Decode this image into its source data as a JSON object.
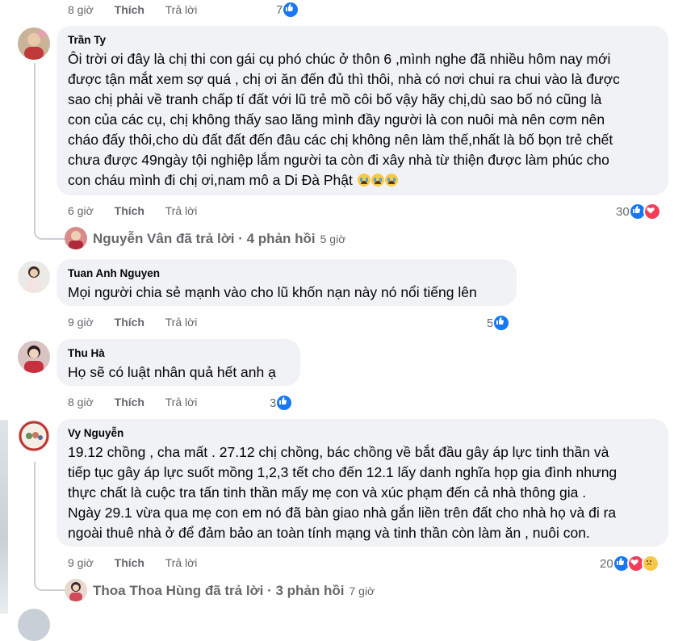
{
  "colors": {
    "like_blue": "#1877f2",
    "love_red": "#f33e58",
    "haha_yellow": "#f7c948",
    "bubble_bg": "#f0f2f5",
    "meta_gray": "#65676b"
  },
  "top_row": {
    "time": "8 giờ",
    "like": "Thích",
    "reply": "Trả lời",
    "reactions": "7"
  },
  "comments": [
    {
      "author": "Trần Ty",
      "text": "Ôi trời ơi đây là chị thi con gái cụ phó chúc ở thôn 6 ,mình nghe đã nhiều hôm nay mới\nđược tận mắt xem sợ quá , chị ơi ăn đến đủ thì thôi, nhà có nơi chui ra chui vào là được\nsao chị phải về tranh chấp tí đất với lũ trẻ mồ côi bố vậy hãy chị,dù sao bố nó cũng là\ncon của các cụ, chị không thấy sao lăng mình đầy người là con nuôi mà nên cơm nên\ncháo đấy thôi,cho dù đất đất đến đâu các chị không nên làm thế,nhất là bố bọn trẻ chết\nchưa được 49ngày tội nghiệp lắm người ta còn đi xây nhà từ thiện được làm phúc cho\ncon cháu mình đi chị ơi,nam mô a Di Đà Phật",
      "emoji_count": 3,
      "time": "6 giờ",
      "like": "Thích",
      "reply": "Trả lời",
      "reactions": "30",
      "reaction_icons": [
        "like-icon",
        "love-icon"
      ],
      "replies": {
        "text": "Nguyễn Vân đã trả lời · 4 phản hồi",
        "time": "5 giờ"
      }
    },
    {
      "author": "Tuan Anh Nguyen",
      "text": "Mọi người chia sẻ mạnh vào cho lũ khốn nạn này nó nổi tiếng lên",
      "time": "9 giờ",
      "like": "Thích",
      "reply": "Trả lời",
      "reactions": "5",
      "reaction_icons": [
        "like-icon"
      ]
    },
    {
      "author": "Thu Hà",
      "text": "Họ sẽ có luật nhân quả hết anh ạ",
      "time": "8 giờ",
      "like": "Thích",
      "reply": "Trả lời",
      "reactions": "3",
      "reaction_icons": [
        "like-icon"
      ]
    },
    {
      "author": "Vy Nguyễn",
      "text": "19.12 chồng , cha mất . 27.12 chị chồng, bác chồng về bắt đầu gây áp lực tinh thần và\ntiếp tục gây áp lực suốt mồng 1,2,3 tết cho đến 12.1 lấy danh nghĩa họp gia đình nhưng\nthực chất là cuộc tra tấn tinh thần mấy mẹ con và xúc phạm đến cả nhà thông gia .\nNgày 29.1 vừa qua mẹ con em nó đã bàn giao nhà gắn liền trên đất cho nhà họ và đi ra\nngoài thuê nhà ở để đảm bảo an toàn tính mạng và tinh thần còn làm ăn , nuôi con.",
      "time": "9 giờ",
      "like": "Thích",
      "reply": "Trả lời",
      "reactions": "20",
      "reaction_icons": [
        "like-icon",
        "love-icon",
        "sad-icon"
      ],
      "replies": {
        "text": "Thoa Thoa Hùng đã trả lời · 3 phản hồi",
        "time": "7 giờ"
      }
    }
  ]
}
